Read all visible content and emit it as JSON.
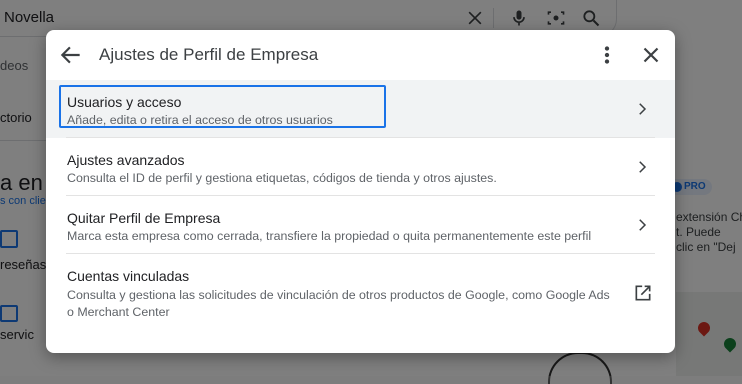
{
  "background": {
    "search_value": "Novella",
    "tab_videos_partial": "deos",
    "tab_directory_partial": "ctorio",
    "title_partial": "a en G",
    "link_partial": "s con clie",
    "reviews_partial": "reseñas",
    "services_partial": "servic",
    "pro_badge": "PRO",
    "side_text": "extensión Ch\nt. Puede\nclic en \"Dej"
  },
  "dialog": {
    "title": "Ajustes de Perfil de Empresa",
    "items": [
      {
        "title": "Usuarios y acceso",
        "description": "Añade, edita o retira el acceso de otros usuarios",
        "trailing_icon": "chevron-right-icon"
      },
      {
        "title": "Ajustes avanzados",
        "description": "Consulta el ID de perfil y gestiona etiquetas, códigos de tienda y otros ajustes.",
        "trailing_icon": "chevron-right-icon"
      },
      {
        "title": "Quitar Perfil de Empresa",
        "description": "Marca esta empresa como cerrada, transfiere la propiedad o quita permanentemente este perfil",
        "trailing_icon": "chevron-right-icon"
      },
      {
        "title": "Cuentas vinculadas",
        "description": "Consulta y gestiona las solicitudes de vinculación de otros productos de Google, como Google Ads o Merchant Center",
        "trailing_icon": "open-in-new-icon"
      }
    ]
  },
  "colors": {
    "focus_accent": "#1a73e8",
    "icon_gray": "#5f6368",
    "text_primary": "#202124"
  }
}
